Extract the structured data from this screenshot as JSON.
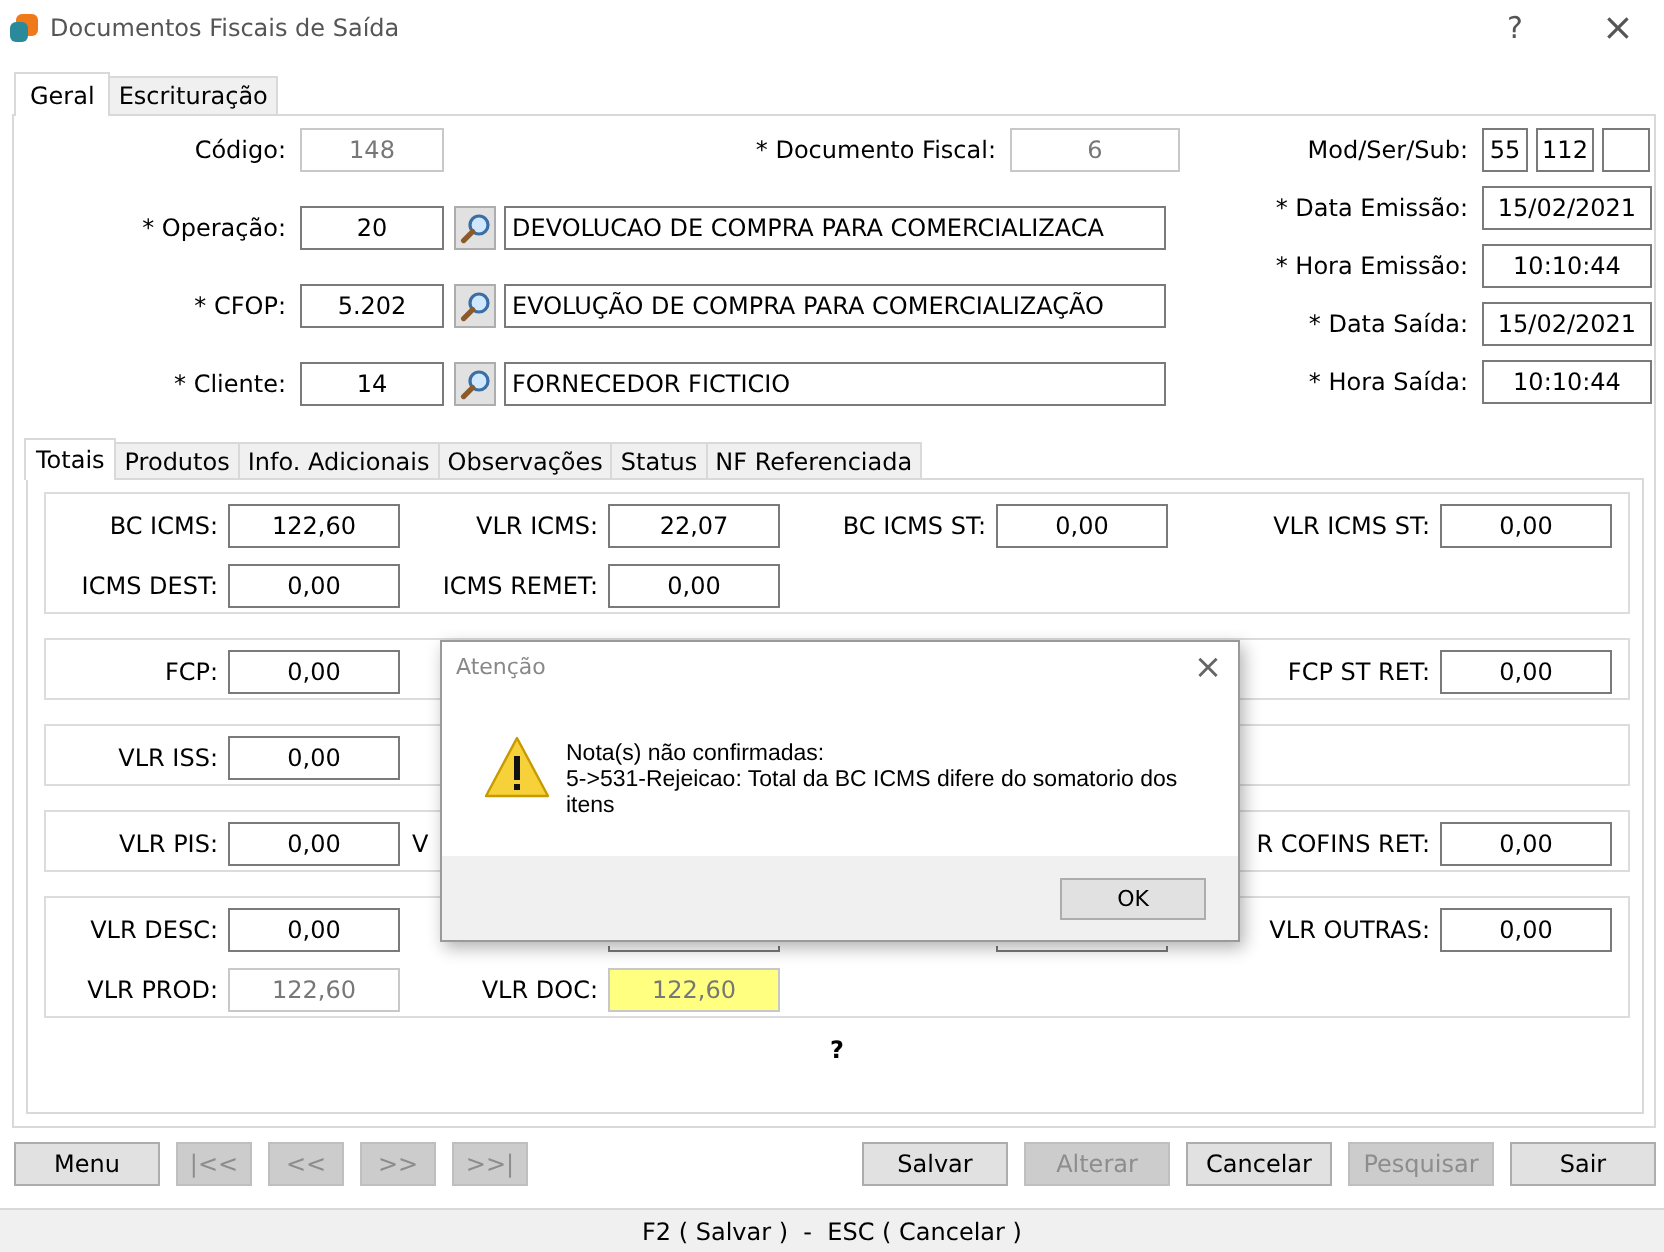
{
  "window": {
    "title": "Documentos Fiscais de Saída",
    "help": "?",
    "close": "×"
  },
  "tabs": [
    {
      "label": "Geral",
      "selected": true
    },
    {
      "label": "Escrituração",
      "selected": false
    }
  ],
  "general": {
    "codigo": {
      "label": "Código:",
      "value": "148",
      "kind": "readonly"
    },
    "documento_fiscal": {
      "label": "* Documento Fiscal:",
      "value": "6",
      "kind": "readonly"
    },
    "lookups": [
      {
        "label": "* Operação:",
        "code": "20",
        "description": "DEVOLUCAO DE COMPRA PARA COMERCIALIZACA"
      },
      {
        "label": "* CFOP:",
        "code": "5.202",
        "description": "EVOLUÇÃO DE COMPRA PARA COMERCIALIZAÇÃO"
      },
      {
        "label": "* Cliente:",
        "code": "14",
        "description": "FORNECEDOR FICTICIO"
      }
    ],
    "mod_ser_sub": {
      "label": "Mod/Ser/Sub:",
      "boxes": [
        {
          "kind": "filled",
          "value": "55"
        },
        {
          "kind": "filled",
          "value": "112"
        },
        {
          "kind": "empty"
        }
      ]
    },
    "dates": [
      {
        "label": "* Data Emissão:",
        "value": "15/02/2021"
      },
      {
        "label": "* Hora Emissão:",
        "value": "10:10:44"
      },
      {
        "label": "* Data Saída:",
        "value": "15/02/2021"
      },
      {
        "label": "* Hora Saída:",
        "value": "10:10:44"
      }
    ]
  },
  "subtabs": [
    {
      "label": "Totais",
      "selected": true
    },
    {
      "label": "Produtos",
      "selected": false
    },
    {
      "label": "Info. Adicionais",
      "selected": false
    },
    {
      "label": "Observações",
      "selected": false
    },
    {
      "label": "Status",
      "selected": false
    },
    {
      "label": "NF Referenciada",
      "selected": false
    }
  ],
  "totals": {
    "groups": [
      {
        "rows": [
          [
            {
              "label": "BC ICMS:",
              "value": "122,60",
              "kind": "input"
            },
            {
              "label": "VLR ICMS:",
              "value": "22,07",
              "kind": "input"
            },
            {
              "label": "BC ICMS ST:",
              "value": "0,00",
              "kind": "input"
            },
            {
              "label": "VLR ICMS ST:",
              "value": "0,00",
              "kind": "input"
            }
          ],
          [
            {
              "label": "ICMS DEST:",
              "value": "0,00",
              "kind": "input"
            },
            {
              "label": "ICMS REMET:",
              "value": "0,00",
              "kind": "input"
            },
            null,
            null
          ]
        ]
      },
      {
        "rows": [
          [
            {
              "label": "FCP:",
              "value": "0,00",
              "kind": "input"
            },
            null,
            null,
            {
              "label": "FCP ST RET:",
              "value": "0,00",
              "kind": "input"
            }
          ]
        ]
      },
      {
        "rows": [
          [
            {
              "label": "VLR ISS:",
              "value": "0,00",
              "kind": "input"
            },
            null,
            null,
            null
          ]
        ]
      },
      {
        "rows": [
          [
            {
              "label": "VLR PIS:",
              "value": "0,00",
              "kind": "input"
            },
            {
              "label": "V",
              "kind": "label-only"
            },
            null,
            {
              "label": "R COFINS RET:",
              "value": "0,00",
              "kind": "input"
            }
          ]
        ]
      },
      {
        "rows": [
          [
            {
              "label": "VLR DESC:",
              "value": "0,00",
              "kind": "input"
            },
            {
              "kind": "covered"
            },
            {
              "kind": "covered"
            },
            {
              "label": "VLR OUTRAS:",
              "value": "0,00",
              "kind": "input"
            }
          ],
          [
            {
              "label": "VLR PROD:",
              "value": "122,60",
              "kind": "readonly"
            },
            {
              "label": "VLR DOC:",
              "value": "122,60",
              "kind": "highlight"
            },
            null,
            null
          ]
        ]
      }
    ],
    "footer_mark": "?"
  },
  "buttons_left": [
    {
      "label": "Menu",
      "disabled": false
    },
    {
      "label": "|<<",
      "disabled": true
    },
    {
      "label": "<<",
      "disabled": true
    },
    {
      "label": ">>",
      "disabled": true
    },
    {
      "label": ">>|",
      "disabled": true
    }
  ],
  "buttons_right": [
    {
      "label": "Salvar",
      "disabled": false
    },
    {
      "label": "Alterar",
      "disabled": true
    },
    {
      "label": "Cancelar",
      "disabled": false
    },
    {
      "label": "Pesquisar",
      "disabled": true
    },
    {
      "label": "Sair",
      "disabled": false
    }
  ],
  "status_bar": "F2 ( Salvar )  -  ESC ( Cancelar )",
  "dialog": {
    "title": "Atenção",
    "close": "×",
    "message": "Nota(s) não confirmadas:\n5->531-Rejeicao: Total da BC ICMS difere do somatorio dos itens",
    "button": "OK"
  }
}
